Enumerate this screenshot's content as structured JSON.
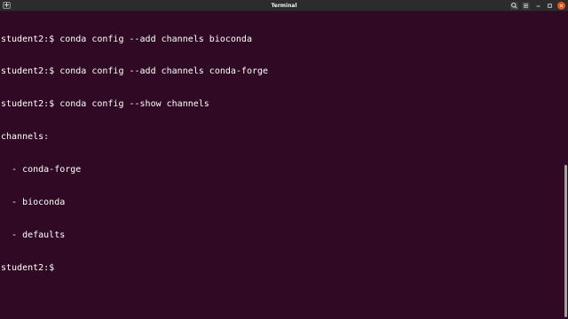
{
  "window": {
    "title": "Terminal"
  },
  "titlebar": {
    "icons": [
      "new-tab-icon",
      "search-icon",
      "hamburger-menu-icon",
      "minimize-icon",
      "maximize-icon",
      "close-icon"
    ]
  },
  "terminal": {
    "lines": [
      "student2:$ conda config --add channels bioconda",
      "student2:$ conda config --add channels conda-forge",
      "student2:$ conda config --show channels",
      "channels:",
      "  - conda-forge",
      "  - bioconda",
      "  - defaults",
      "student2:$ "
    ]
  },
  "colors": {
    "background": "#300a24",
    "titlebar": "#2c2c2c",
    "text": "#ffffff",
    "close_button": "#e95420"
  }
}
